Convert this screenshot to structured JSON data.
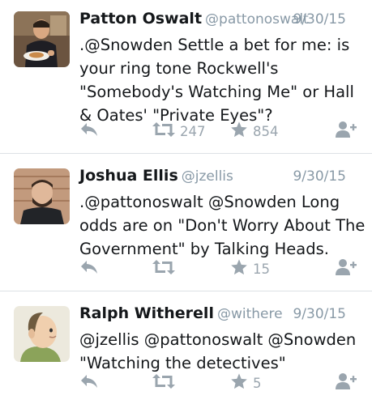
{
  "tweets": [
    {
      "name": "Patton Oswalt",
      "handle": "@pattonoswalt",
      "date": "9/30/15",
      "lines": [
        ".@Snowden Settle a bet for me: is",
        "your ring tone Rockwell's",
        "\"Somebody's Watching Me\" or Hall",
        "& Oates' \"Private Eyes\"?"
      ],
      "retweets": "247",
      "likes": "854"
    },
    {
      "name": "Joshua Ellis",
      "handle": "@jzellis",
      "date": "9/30/15",
      "lines": [
        ".@pattonoswalt @Snowden Long",
        "odds are on \"Don't Worry About The",
        "Government\" by Talking Heads."
      ],
      "retweets": "",
      "likes": "15"
    },
    {
      "name": "Ralph Witherell",
      "handle": "@withere",
      "date": "9/30/15",
      "lines": [
        "@jzellis @pattonoswalt @Snowden",
        "\"Watching the detectives\""
      ],
      "retweets": "",
      "likes": "5"
    }
  ],
  "icons": {
    "reply": "reply-icon",
    "retweet": "retweet-icon",
    "like": "star-icon",
    "follow": "follow-icon"
  },
  "colors": {
    "text": "#14171a",
    "muted": "#8899a6",
    "icon": "#9aa5ae",
    "divider": "#dde1e5"
  }
}
